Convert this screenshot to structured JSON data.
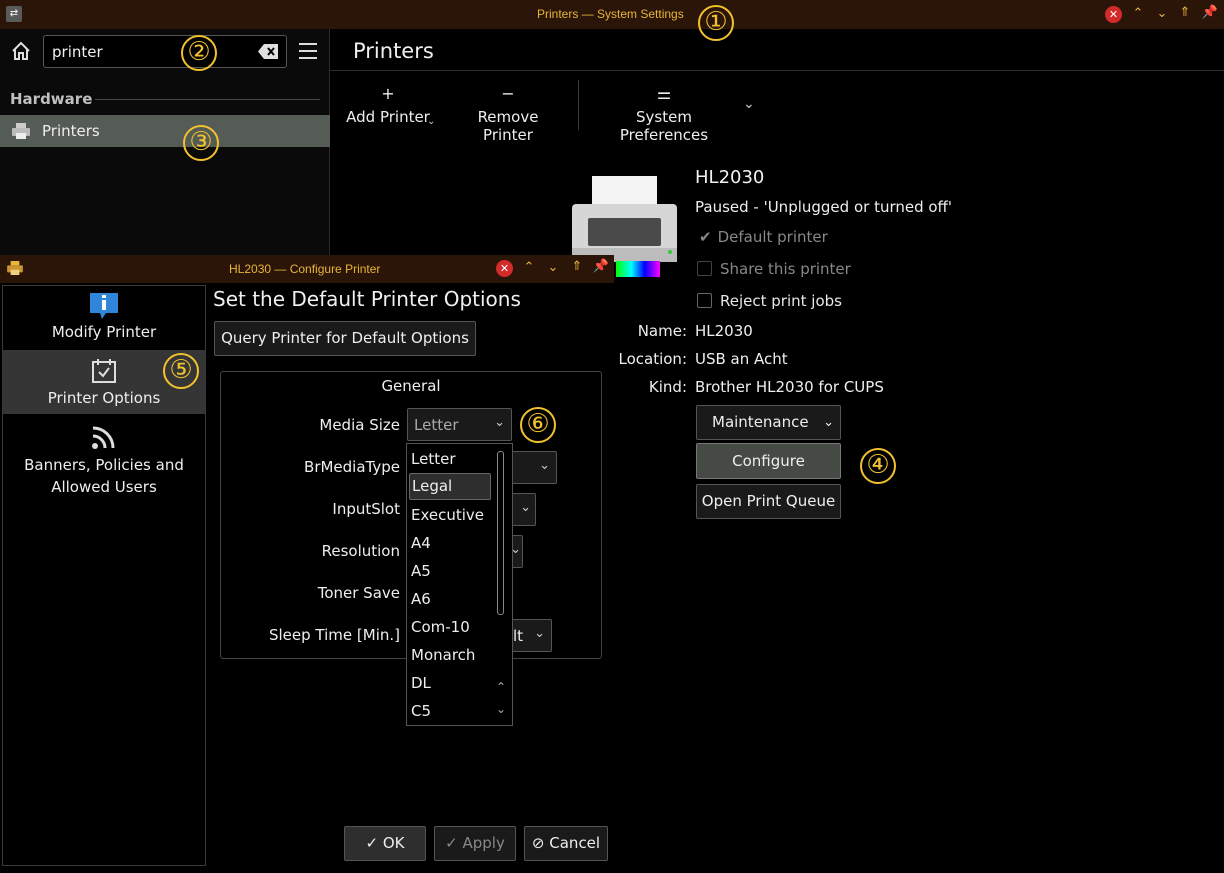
{
  "window": {
    "title": "Printers — System Settings",
    "controls": [
      "close",
      "minimize",
      "maximize",
      "keep-above",
      "pin"
    ]
  },
  "badges": [
    "①",
    "②",
    "③",
    "④",
    "⑤",
    "⑥"
  ],
  "sidebar": {
    "search_value": "printer",
    "section": "Hardware",
    "items": [
      {
        "label": "Printers",
        "icon": "printer-icon",
        "selected": true
      }
    ]
  },
  "main": {
    "title": "Printers",
    "toolbar": {
      "add": "Add Printer",
      "remove": "Remove Printer",
      "prefs": "System Preferences"
    },
    "printer": {
      "name": "HL2030",
      "status": "Paused - 'Unplugged or turned off'",
      "default_label": "Default printer",
      "share_label": "Share this printer",
      "reject_label": "Reject print jobs",
      "fields": [
        {
          "key": "Name:",
          "value": "HL2030"
        },
        {
          "key": "Location:",
          "value": "USB an Acht"
        },
        {
          "key": "Kind:",
          "value": "Brother HL2030 for CUPS"
        }
      ],
      "maintenance": "Maintenance",
      "configure": "Configure",
      "open_queue": "Open Print Queue"
    }
  },
  "dialog": {
    "title": "HL2030 — Configure Printer",
    "sidebar": [
      {
        "label": "Modify Printer",
        "icon": "info-icon"
      },
      {
        "label": "Printer Options",
        "icon": "checklist-icon",
        "selected": true
      },
      {
        "label": "Banners, Policies and Allowed Users",
        "icon": "rss-icon"
      }
    ],
    "heading": "Set the Default Printer Options",
    "query_button": "Query Printer for Default Options",
    "group_title": "General",
    "options": [
      {
        "label": "Media Size",
        "value": "Letter"
      },
      {
        "label": "BrMediaType",
        "value": ""
      },
      {
        "label": "InputSlot",
        "value": ""
      },
      {
        "label": "Resolution",
        "value": ""
      },
      {
        "label": "Toner Save",
        "value": ""
      },
      {
        "label": "Sleep Time [Min.]",
        "value": "lt"
      }
    ],
    "media_dropdown": [
      "Letter",
      "Legal",
      "Executive",
      "A4",
      "A5",
      "A6",
      "Com-10",
      "Monarch",
      "DL",
      "C5"
    ],
    "media_dropdown_highlighted": "Legal",
    "buttons": {
      "ok": "OK",
      "apply": "Apply",
      "cancel": "Cancel"
    },
    "colors": {
      "accent_badge": "#f2c12e",
      "titlebar": "#2a1508",
      "close": "#d32a2a"
    }
  }
}
